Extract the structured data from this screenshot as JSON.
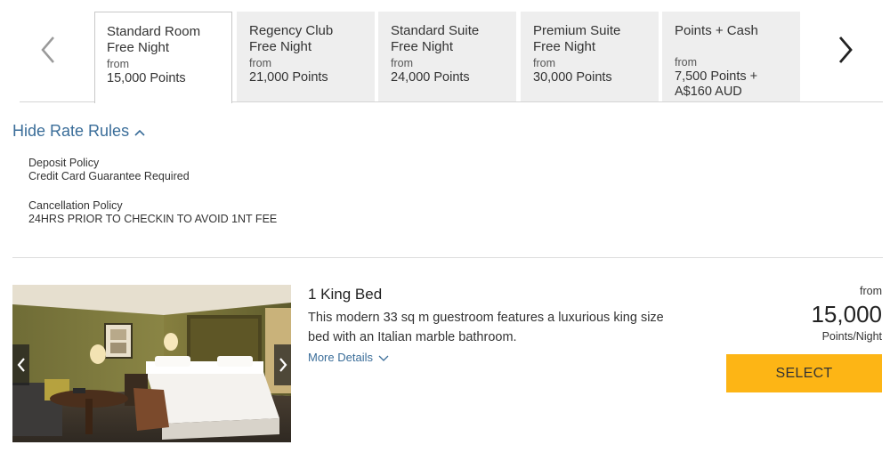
{
  "tabs": [
    {
      "title": "Standard Room Free Night",
      "from": "from",
      "price": "15,000 Points",
      "active": true
    },
    {
      "title": "Regency Club Free Night",
      "from": "from",
      "price": "21,000 Points",
      "active": false
    },
    {
      "title": "Standard Suite Free Night",
      "from": "from",
      "price": "24,000 Points",
      "active": false
    },
    {
      "title": "Premium Suite Free Night",
      "from": "from",
      "price": "30,000 Points",
      "active": false
    },
    {
      "title": "Points + Cash",
      "from": "from",
      "price": "7,500 Points + A$160 AUD",
      "active": false
    }
  ],
  "nav": {
    "prev_icon": "chevron-left-icon",
    "next_icon": "chevron-right-icon"
  },
  "rate_rules": {
    "toggle_label": "Hide Rate Rules",
    "toggle_icon": "chevron-up-icon",
    "policies": [
      {
        "title": "Deposit Policy",
        "value": "Credit Card Guarantee Required"
      },
      {
        "title": "Cancellation Policy",
        "value": "24HRS PRIOR TO CHECKIN TO AVOID 1NT FEE"
      }
    ]
  },
  "room": {
    "name": "1 King Bed",
    "description": "This modern 33 sq m guestroom features a luxurious king size bed with an Italian marble bathroom.",
    "more_details": "More Details",
    "price_from": "from",
    "price": "15,000",
    "price_unit": "Points/Night",
    "select_label": "SELECT"
  },
  "colors": {
    "link": "#3a6d99",
    "select_button": "#fdb515",
    "inactive_tab": "#eeeeee"
  }
}
